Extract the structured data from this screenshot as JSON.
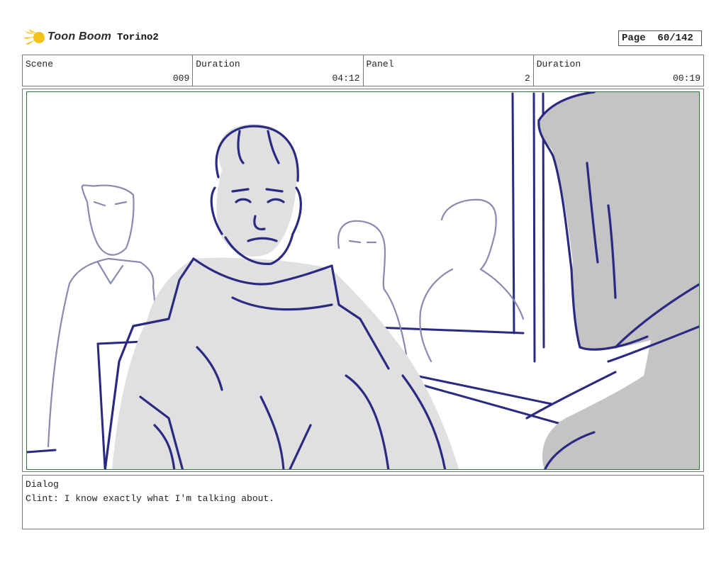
{
  "header": {
    "logo_text": "Toon Boom",
    "project": "Torino2",
    "page_label": "Page",
    "page_value": "60/142"
  },
  "info": {
    "scene_label": "Scene",
    "scene_value": "009",
    "duration_label": "Duration",
    "duration_value": "04:12",
    "panel_label": "Panel",
    "panel_value": "2",
    "panel_duration_label": "Duration",
    "panel_duration_value": "00:19"
  },
  "dialog": {
    "label": "Dialog",
    "text": "Clint: I know exactly what I'm talking about."
  },
  "colors": {
    "ink": "#2a2a82",
    "ink_light": "#8a8ab0",
    "fill_light": "#e0e0e0",
    "fill_dark": "#c4c4c4",
    "panel_border": "#2e7d32",
    "logo_yellow": "#f2c21b"
  }
}
